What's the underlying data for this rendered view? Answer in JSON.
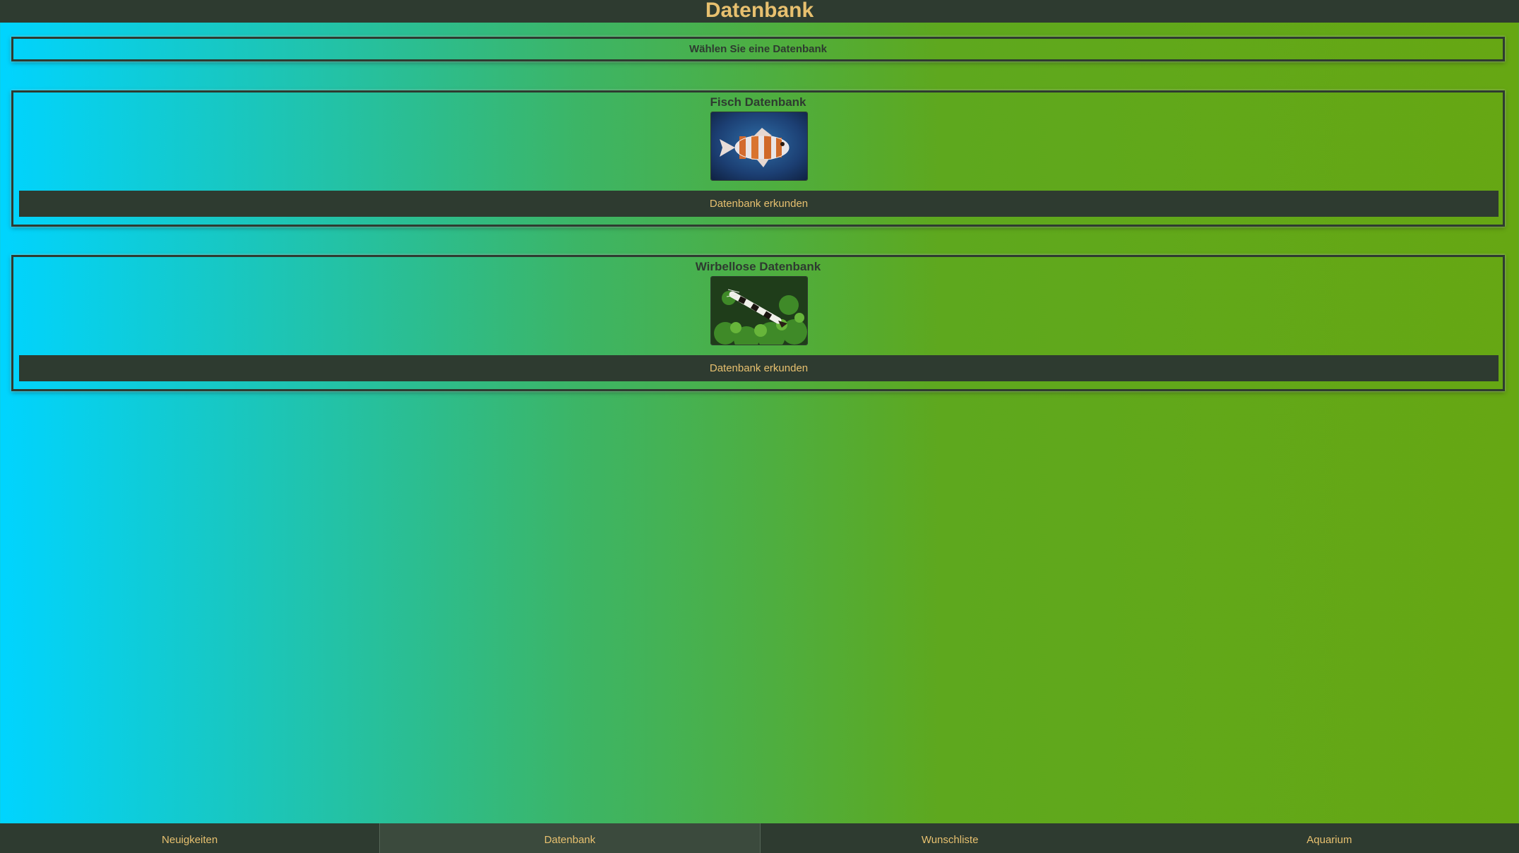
{
  "header": {
    "title": "Datenbank"
  },
  "select_banner": {
    "label": "Wählen Sie eine Datenbank"
  },
  "databases": [
    {
      "title": "Fisch Datenbank",
      "image_icon": "fish-photo",
      "button_label": "Datenbank erkunden"
    },
    {
      "title": "Wirbellose Datenbank",
      "image_icon": "shrimp-photo",
      "button_label": "Datenbank erkunden"
    }
  ],
  "tabs": [
    {
      "label": "Neuigkeiten",
      "active": false
    },
    {
      "label": "Datenbank",
      "active": true
    },
    {
      "label": "Wunschliste",
      "active": false
    },
    {
      "label": "Aquarium",
      "active": false
    }
  ],
  "colors": {
    "dark": "#2e3b30",
    "accent": "#e7c06f",
    "gradient_start": "#00d4ff",
    "gradient_end": "#66a713"
  }
}
